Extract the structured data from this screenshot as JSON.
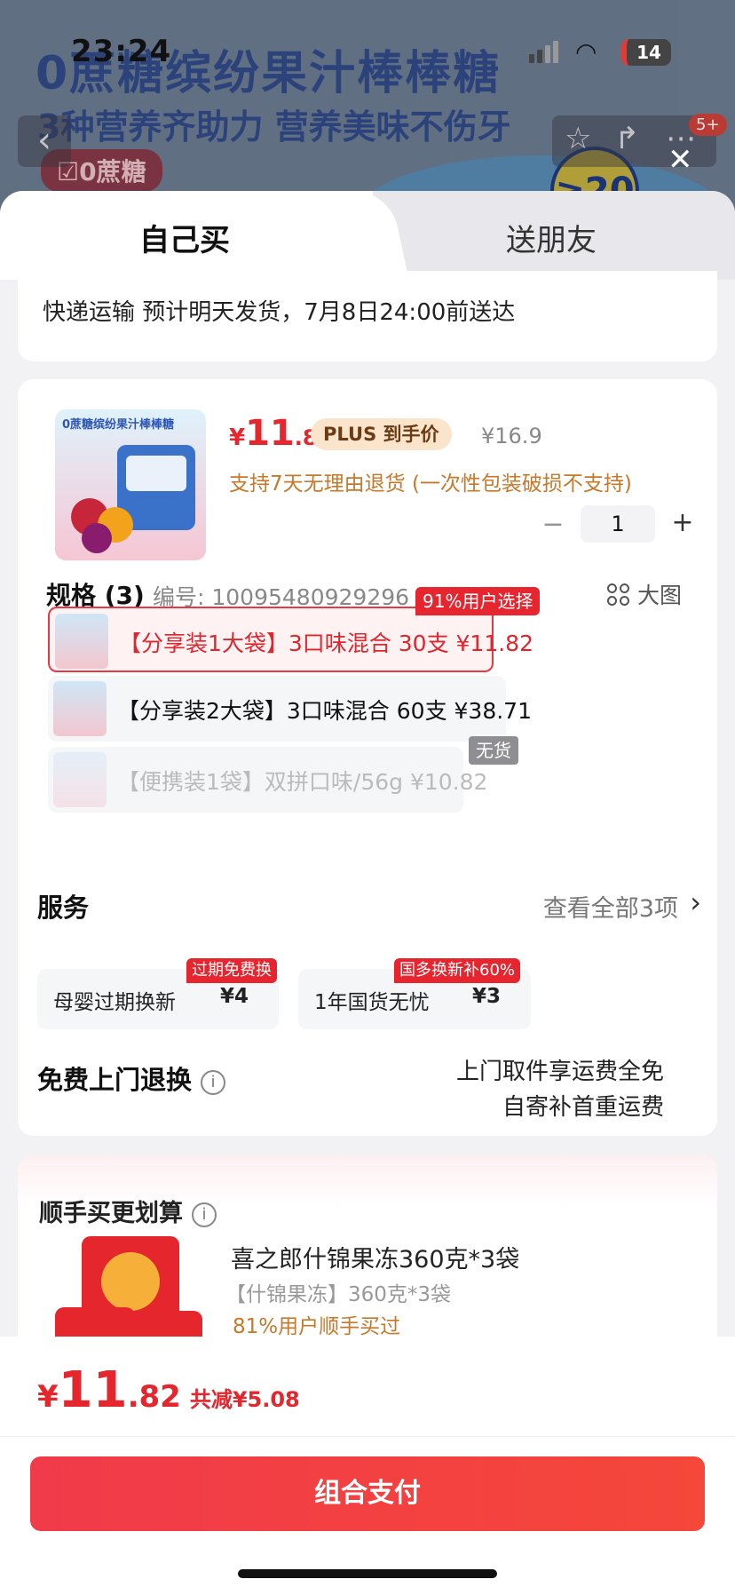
{
  "status_bar": {
    "time": "23:24",
    "battery": "14"
  },
  "background": {
    "title": "0蔗糖缤纷果汁棒棒糖",
    "subtitle": "3种营养齐助力 营养美味不伤牙",
    "badge": "☑0蔗糖",
    "coin": "≥20",
    "cart_count": "5+"
  },
  "tabs": {
    "self": "自己买",
    "friend": "送朋友"
  },
  "shipping": {
    "text": "快递运输 预计明天发货，7月8日24:00前送达"
  },
  "product": {
    "thumb_caption": "0蔗糖缤纷果汁棒棒糖",
    "price_yen": "¥",
    "price_int": "11",
    "price_dec": ".82",
    "plus_tag": "PLUS 到手价",
    "original_price": "¥16.9",
    "return_note": "支持7天无理由退货 (一次性包装破损不支持)",
    "quantity": "1"
  },
  "spec": {
    "title": "规格 (3)",
    "code": "编号: 10095480929296",
    "big_pic": "大图",
    "variants": [
      {
        "label": "【分享装1大袋】3口味混合 30支   ¥11.82",
        "tag": "91%用户选择",
        "state": "selected"
      },
      {
        "label": "【分享装2大袋】3口味混合 60支   ¥38.71",
        "tag": "",
        "state": "normal"
      },
      {
        "label": "【便携装1袋】双拼口味/56g   ¥10.82",
        "tag": "无货",
        "state": "disabled"
      }
    ]
  },
  "services": {
    "title": "服务",
    "more": "查看全部3项",
    "items": [
      {
        "name": "母婴过期换新",
        "price": "¥4",
        "tag": "过期免费换"
      },
      {
        "name": "1年国货无忧",
        "price": "¥3",
        "tag": "国多换新补60%"
      }
    ]
  },
  "free_return": {
    "title": "免费上门退换",
    "desc_line1": "上门取件享运费全免",
    "desc_line2": "自寄补首重运费"
  },
  "bundle": {
    "title": "顺手买更划算",
    "name": "喜之郎什锦果冻360克*3袋",
    "spec": "【什锦果冻】360克*3袋",
    "rate": "81%用户顺手买过"
  },
  "footer": {
    "yen": "¥",
    "int": "11",
    "dec": ".82",
    "save": "共减¥5.08",
    "pay_button": "组合支付"
  },
  "colors": {
    "accent": "#e5262d",
    "tag_orange": "#c7782a",
    "plus_bg": "#fbe4cc"
  }
}
